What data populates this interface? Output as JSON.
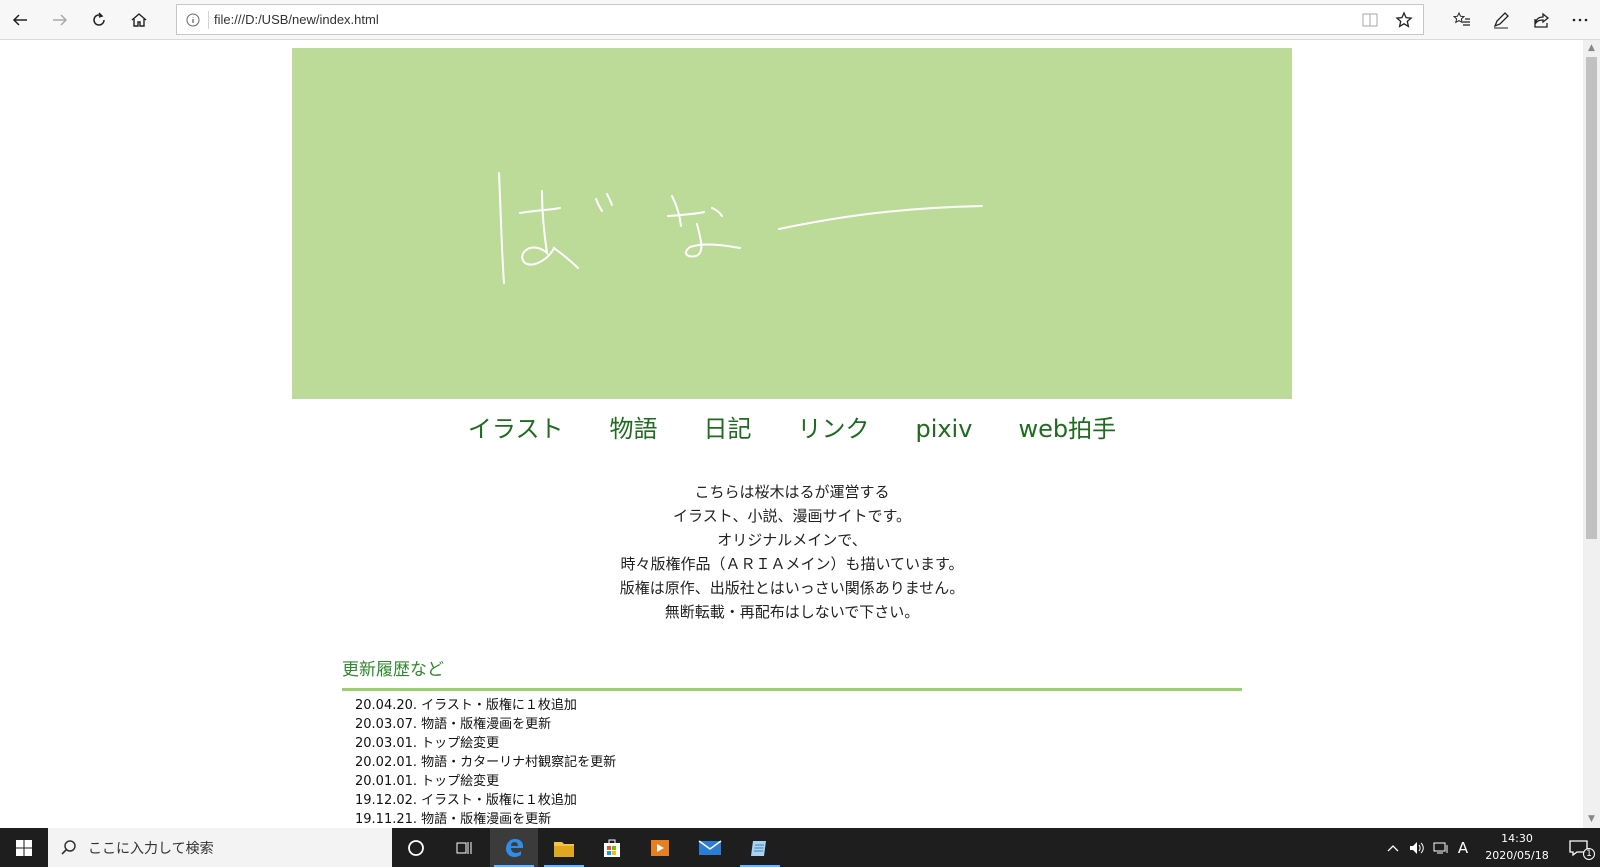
{
  "browser": {
    "url": "file:///D:/USB/new/index.html",
    "icons": [
      "back-icon",
      "forward-icon",
      "refresh-icon",
      "home-icon",
      "info-icon",
      "reading-view-icon",
      "favorite-star-icon",
      "favorites-list-icon",
      "notes-pen-icon",
      "share-icon",
      "more-icon"
    ]
  },
  "site": {
    "nav": [
      "イラスト",
      "物語",
      "日記",
      "リンク",
      "pixiv",
      "web拍手"
    ],
    "intro": [
      "こちらは桜木はるが運営する",
      "イラスト、小説、漫画サイトです。",
      "オリジナルメインで、",
      "時々版権作品（ＡＲＩＡメイン）も描いています。",
      "版権は原作、出版社とはいっさい関係ありません。",
      "無断転載・再配布はしないで下さい。"
    ],
    "history_title": "更新履歴など",
    "history": [
      "20.04.20. イラスト・版権に１枚追加",
      "20.03.07. 物語・版権漫画を更新",
      "20.03.01. トップ絵変更",
      "20.02.01. 物語・カターリナ村観察記を更新",
      "20.01.01. トップ絵変更",
      "19.12.02. イラスト・版権に１枚追加",
      "19.11.21. 物語・版権漫画を更新"
    ],
    "colors": {
      "hero_bg": "#bcdb98",
      "nav_text": "#1f6b1f",
      "heading": "#2f8a2f",
      "rule": "#9bcf6f"
    }
  },
  "taskbar": {
    "search_placeholder": "ここに入力して検索",
    "ime": "A",
    "time": "14:30",
    "date": "2020/05/18",
    "notification_count": "1",
    "icons": [
      "windows-start-icon",
      "search-icon",
      "cortana-icon",
      "task-view-icon",
      "edge-icon",
      "file-explorer-icon",
      "store-icon",
      "media-player-icon",
      "mail-icon",
      "notepad-icon",
      "chevron-up-icon",
      "volume-icon",
      "network-icon",
      "notification-icon"
    ]
  }
}
